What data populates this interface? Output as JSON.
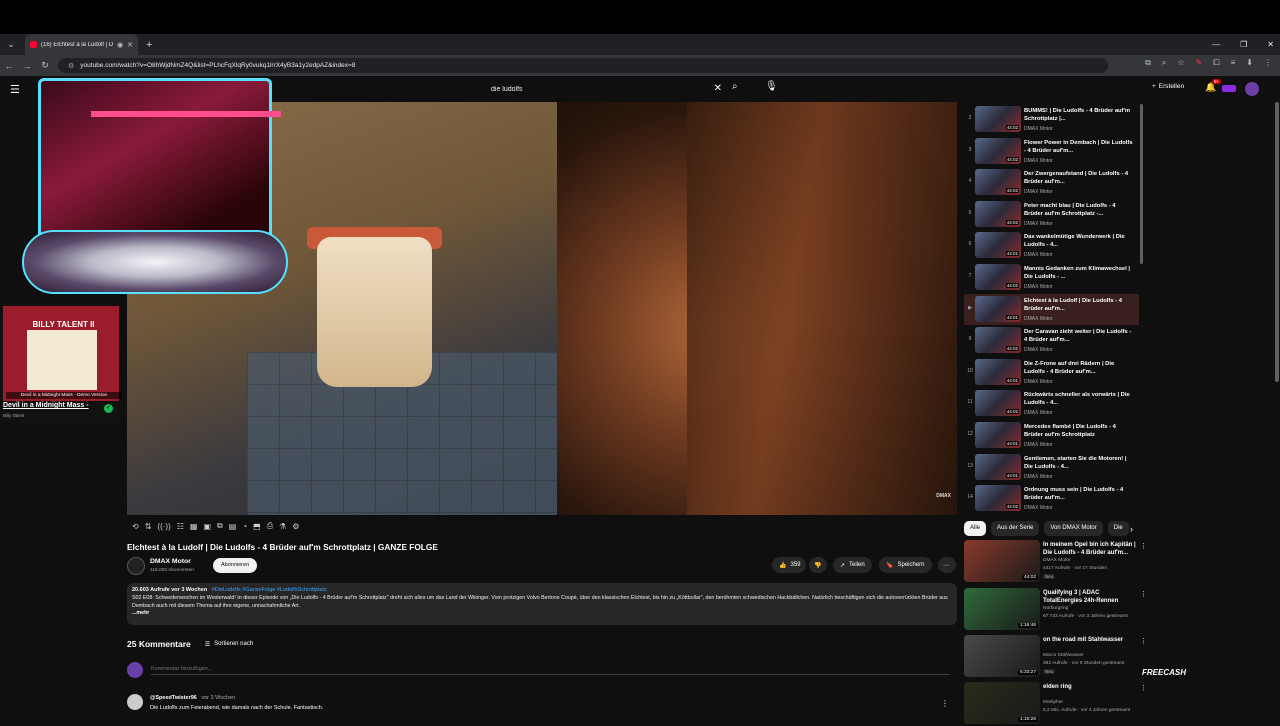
{
  "browser": {
    "tab_title": "(16) Elchtest à la Ludolf | Di",
    "url": "youtube.com/watch?v=O8hWjdNmZ4Q&list=PLhcFqXlqRy0vukq1lrrX4yB3a1y2edpAZ&index=8"
  },
  "header": {
    "search_value": "die ludolfs",
    "create_label": "Erstellen",
    "notif_count": "9+"
  },
  "video": {
    "title": "Elchtest à la Ludolf | Die Ludolfs - 4 Brüder auf'm Schrottplatz | GANZE FOLGE",
    "watermark": "DMAX",
    "channel_name": "DMAX Motor",
    "channel_subs": "115.000 Abonnenten",
    "subscribe_label": "Abonnieren",
    "likes": "359",
    "share_label": "Teilen",
    "save_label": "Speichern"
  },
  "description": {
    "views": "20.603 Aufrufe",
    "age": "vor 3 Wochen",
    "tags": "#DieLudolfs #GanzeFolge #LudolfsSchrottplatz",
    "text": "S02 E08: Schwedenwochen im Westerwald! In dieser Episode von „Die Ludolfs - 4 Brüder auf'm Schrottplatz\" dreht sich alles um das Land der Wikinger. Vom protzigen Volvo Bertone Coupé, über den klassischen Elchtest, bis hin zu „Köttbullar\", den berühmten schwedischen Hackbällchen. Natürlich beschäftigen sich die autoverrückten Brüder aus Dembach auch mit diesem Thema auf ihre eigene, unnachahmliche Art.",
    "more": "...mehr"
  },
  "comments": {
    "count_label": "25 Kommentare",
    "sort_label": "Sortieren nach",
    "placeholder": "Kommentar hinzufügen...",
    "first": {
      "user": "@SpeedTwister96",
      "when": "vor 3 Wochen",
      "text": "Die Ludolfs zum Feierabend, wie damals nach der Schule. Fantastisch."
    }
  },
  "overlay": {
    "album_title": "BILLY TALENT II",
    "album_caption": "Devil in a Midnight Mass - Demo Version",
    "track_title": "Devil in a Midnight Mass -",
    "track_artist": "Billy Talent"
  },
  "playlist": [
    {
      "num": "2",
      "title": "BUMMS! | Die Ludolfs - 4 Brüder auf'm Schrottplatz |...",
      "channel": "DMAX Motor",
      "duration": "44:02",
      "active": false
    },
    {
      "num": "3",
      "title": "Flower Power in Dembach | Die Ludolfs - 4 Brüder auf'm...",
      "channel": "DMAX Motor",
      "duration": "44:02",
      "active": false
    },
    {
      "num": "4",
      "title": "Der Zwergenaufstand | Die Ludolfs - 4 Brüder auf'm...",
      "channel": "DMAX Motor",
      "duration": "44:02",
      "active": false
    },
    {
      "num": "5",
      "title": "Peter macht blau | Die Ludolfs - 4 Brüder auf'm Schrottplatz -...",
      "channel": "DMAX Motor",
      "duration": "44:02",
      "active": false
    },
    {
      "num": "6",
      "title": "Das wankelmütige Wunderwerk | Die Ludolfs - 4...",
      "channel": "DMAX Motor",
      "duration": "44:01",
      "active": false
    },
    {
      "num": "7",
      "title": "Mannis Gedanken zum Klimawechsel | Die Ludolfs - ...",
      "channel": "DMAX Motor",
      "duration": "44:02",
      "active": false
    },
    {
      "num": "▶",
      "title": "Elchtest à la Ludolf | Die Ludolfs - 4 Brüder auf'm...",
      "channel": "DMAX Motor",
      "duration": "44:01",
      "active": true
    },
    {
      "num": "9",
      "title": "Der Caravan zieht weiter | Die Ludolfs - 4 Brüder auf'm...",
      "channel": "DMAX Motor",
      "duration": "44:02",
      "active": false
    },
    {
      "num": "10",
      "title": "Die Z-Frone auf drei Rädern | Die Ludolfs - 4 Brüder auf'm...",
      "channel": "DMAX Motor",
      "duration": "44:01",
      "active": false
    },
    {
      "num": "11",
      "title": "Rückwärts schneller als vorwärts | Die Ludolfs - 4...",
      "channel": "DMAX Motor",
      "duration": "44:02",
      "active": false
    },
    {
      "num": "12",
      "title": "Mercedes flambé | Die Ludolfs - 4 Brüder auf'm Schrottplatz",
      "channel": "DMAX Motor",
      "duration": "44:01",
      "active": false
    },
    {
      "num": "13",
      "title": "Gentlemen, starten Sie die Motoren! | Die Ludolfs - 4...",
      "channel": "DMAX Motor",
      "duration": "44:01",
      "active": false
    },
    {
      "num": "14",
      "title": "Ordnung muss sein | Die Ludolfs - 4 Brüder auf'm...",
      "channel": "DMAX Motor",
      "duration": "44:02",
      "active": false
    }
  ],
  "chips": [
    "Alle",
    "Aus der Serie",
    "Von DMAX Motor",
    "Die"
  ],
  "recommendations": [
    {
      "title": "In meinem Opel bin ich Kapitän | Die Ludolfs - 4 Brüder auf'm...",
      "channel": "DMAX Motor",
      "meta": "4417 Aufrufe · vor 17 Stunden",
      "badge": "Neu",
      "duration": "44:02",
      "color": "#8a3a2a"
    },
    {
      "title": "Qualifying 3 | ADAC TotalEnergies 24h-Rennen",
      "channel": "Nürburgring",
      "meta": "67.733 Aufrufe · vor 3 Jahren gestreamt",
      "badge": "",
      "duration": "1:16:46",
      "color": "#2f6a3a"
    },
    {
      "title": "on the road mit Stahlwasser",
      "channel": "Marco Stahlwasser",
      "meta": "392 Aufrufe · vor 9 Stunden gestreamt",
      "badge": "Neu",
      "duration": "6:33:27",
      "color": "#4a4a4a"
    },
    {
      "title": "elden ring",
      "channel": "Marlipher",
      "meta": "5,2 Mio. Aufrufe · vor 4 Jahren gestreamt",
      "badge": "",
      "duration": "1:15:26",
      "color": "#2a2a1a"
    }
  ],
  "freecash_label": "FREECASH"
}
